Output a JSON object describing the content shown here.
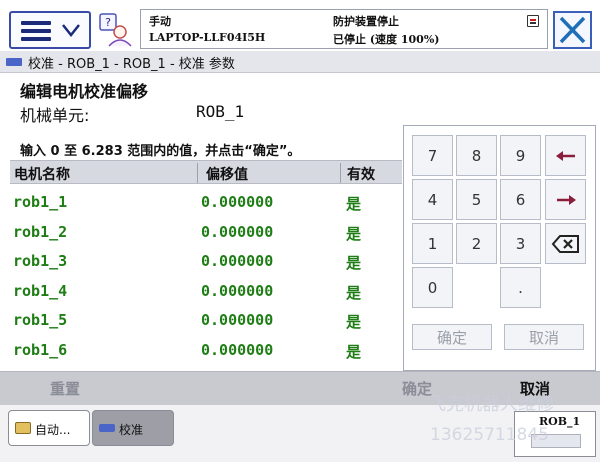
{
  "header": {
    "mode_label": "手动",
    "computer_name": "LAPTOP-LLF04I5H",
    "safeguard_status": "防护装置停止",
    "run_status": "已停止 (速度 100%)"
  },
  "breadcrumb": "校准 - ROB_1 - ROB_1 - 校准 参数",
  "page": {
    "title": "编辑电机校准偏移",
    "unit_label": "机械单元:",
    "unit_value": "ROB_1",
    "instruction": "输入 0 至 6.283 范围内的值，并点击“确定”。"
  },
  "table": {
    "headers": [
      "电机名称",
      "偏移值",
      "有效"
    ],
    "rows": [
      {
        "name": "rob1_1",
        "offset": "0.000000",
        "valid": "是"
      },
      {
        "name": "rob1_2",
        "offset": "0.000000",
        "valid": "是"
      },
      {
        "name": "rob1_3",
        "offset": "0.000000",
        "valid": "是"
      },
      {
        "name": "rob1_4",
        "offset": "0.000000",
        "valid": "是"
      },
      {
        "name": "rob1_5",
        "offset": "0.000000",
        "valid": "是"
      },
      {
        "name": "rob1_6",
        "offset": "0.000000",
        "valid": "是"
      }
    ]
  },
  "keypad": {
    "digits": [
      "7",
      "8",
      "9",
      "4",
      "5",
      "6",
      "1",
      "2",
      "3",
      "0",
      "."
    ],
    "ok_label": "确定",
    "cancel_label": "取消"
  },
  "actions": {
    "reset_label": "重置",
    "ok_label": "确定",
    "cancel_label": "取消"
  },
  "taskbar": {
    "task1_label": "自动...",
    "task2_label": "校准",
    "robot_label": "ROB_1"
  },
  "watermark": {
    "text1": "飞克机器人维修",
    "text2": "13625711845"
  },
  "colors": {
    "value_green": "#1e7d14",
    "accent_blue": "#3a4aa8",
    "toolbar_gray": "#c9cad0"
  }
}
